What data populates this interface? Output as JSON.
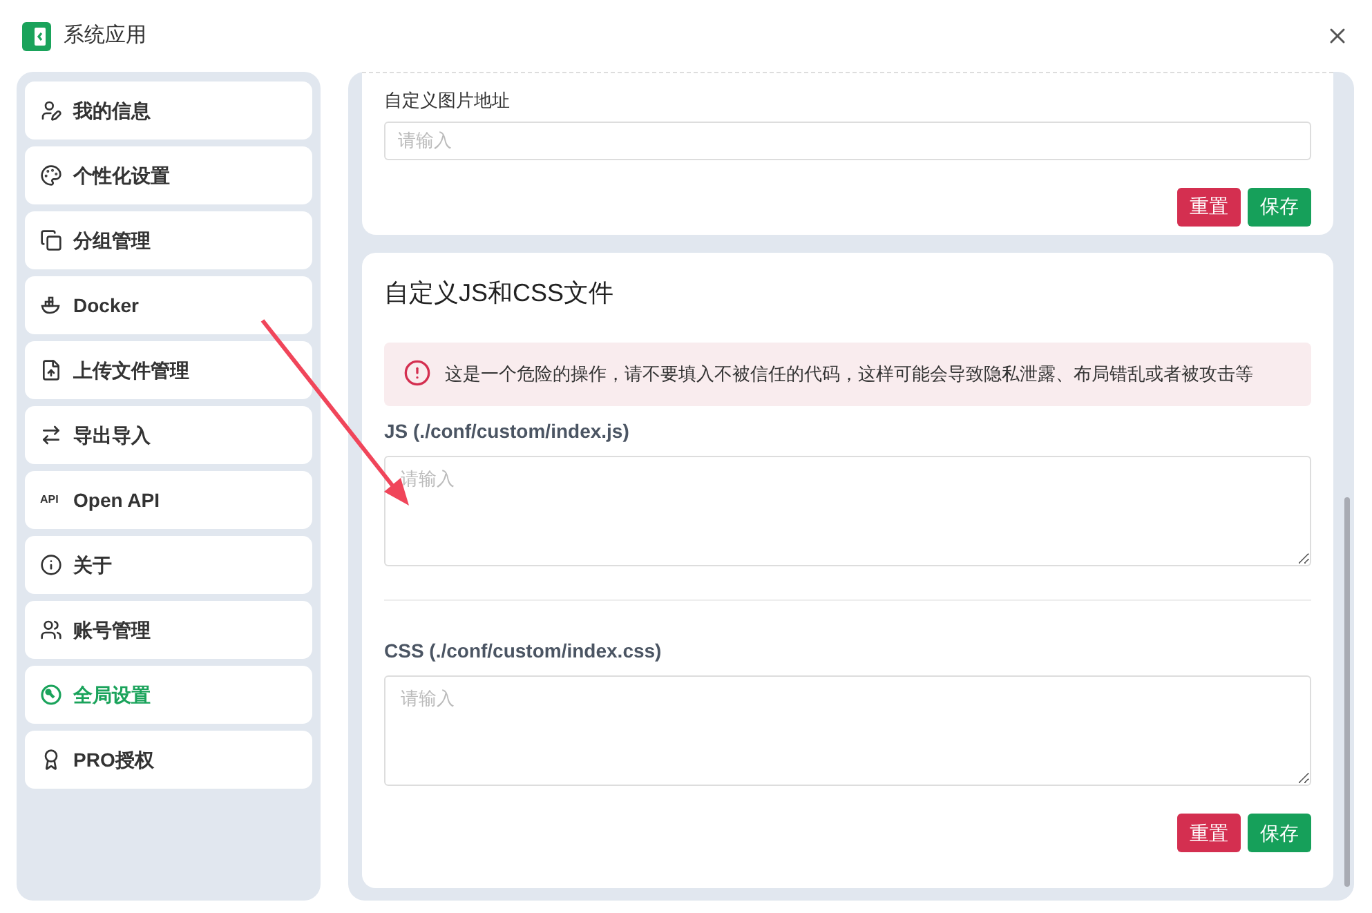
{
  "window": {
    "title": "系统应用"
  },
  "sidebar": {
    "items": [
      {
        "label": "我的信息",
        "selected": false
      },
      {
        "label": "个性化设置",
        "selected": false
      },
      {
        "label": "分组管理",
        "selected": false
      },
      {
        "label": "Docker",
        "selected": false
      },
      {
        "label": "上传文件管理",
        "selected": false
      },
      {
        "label": "导出导入",
        "selected": false
      },
      {
        "label": "Open API",
        "icon_text": "API",
        "selected": false
      },
      {
        "label": "关于",
        "selected": false
      },
      {
        "label": "账号管理",
        "selected": false
      },
      {
        "label": "全局设置",
        "selected": true
      },
      {
        "label": "PRO授权",
        "selected": false
      }
    ]
  },
  "image_card": {
    "label": "自定义图片地址",
    "placeholder": "请输入",
    "buttons": [
      "重置",
      "保存"
    ]
  },
  "custom_files_card": {
    "title": "自定义JS和CSS文件",
    "alert": "这是一个危险的操作，请不要填入不被信任的代码，这样可能会导致隐私泄露、布局错乱或者被攻击等",
    "fields": [
      {
        "label": "JS (./conf/custom/index.js)",
        "placeholder": "请输入"
      },
      {
        "label": "CSS (./conf/custom/index.css)",
        "placeholder": "请输入"
      }
    ],
    "buttons": [
      "重置",
      "保存"
    ]
  }
}
